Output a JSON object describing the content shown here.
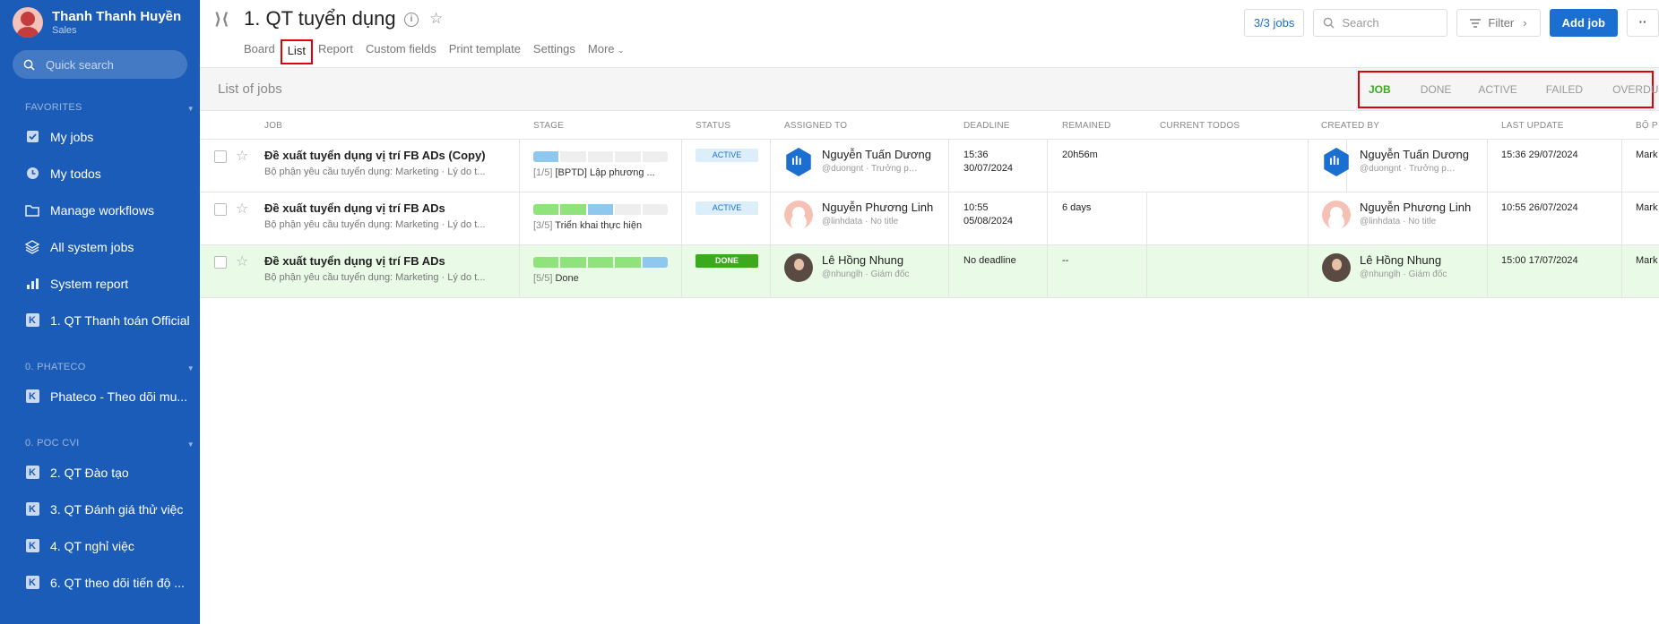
{
  "user": {
    "name": "Thanh Thanh Huyền",
    "role": "Sales"
  },
  "sidebar": {
    "search_placeholder": "Quick search",
    "sections": {
      "favorites": "FAVORITES",
      "phateco": "0. PHATECO",
      "poc": "0. POC CVI"
    },
    "items": {
      "my_jobs": "My jobs",
      "my_todos": "My todos",
      "manage_workflows": "Manage workflows",
      "all_system_jobs": "All system jobs",
      "system_report": "System report",
      "qt_thanh_toan": "1. QT Thanh toán Official",
      "phateco_theo_doi": "Phateco - Theo dõi mu...",
      "qt_dao_tao": "2. QT Đào tạo",
      "qt_danh_gia": "3. QT Đánh giá thử việc",
      "qt_nghi_viec": "4. QT nghỉ việc",
      "qt_theo_doi": "6. QT theo dõi tiến độ ..."
    }
  },
  "header": {
    "title": "1. QT tuyển dụng",
    "tabs": [
      "Board",
      "List",
      "Report",
      "Custom fields",
      "Print template",
      "Settings",
      "More"
    ],
    "jobs_count": "3/3 jobs",
    "search_placeholder": "Search",
    "filter_label": "Filter",
    "add_job_label": "Add job",
    "more_label": "··"
  },
  "subheader": {
    "title": "List of jobs",
    "filters": [
      "JOB",
      "DONE",
      "ACTIVE",
      "FAILED",
      "OVERDUE"
    ]
  },
  "table": {
    "columns": {
      "job": "JOB",
      "stage": "STAGE",
      "status": "STATUS",
      "assigned": "ASSIGNED TO",
      "deadline": "DEADLINE",
      "remained": "REMAINED",
      "todos": "CURRENT TODOS",
      "created": "CREATED BY",
      "updated": "LAST UPDATE",
      "bop": "BỘ P"
    },
    "rows": [
      {
        "title": "Đề xuất tuyển dụng vị trí FB ADs (Copy)",
        "subtitle": "Bộ phận yêu cầu tuyển dụng: Marketing · Lý do t...",
        "stage_num": "[1/5]",
        "stage_text": "[BPTD] Lập phương ...",
        "status": "ACTIVE",
        "assigned_name": "Nguyễn Tuấn Dương",
        "assigned_sub": "@duongnt · Trưởng phò...",
        "deadline_time": "15:36",
        "deadline_date": "30/07/2024",
        "remained": "20h56m",
        "created_name": "Nguyễn Tuấn Dương",
        "created_sub": "@duongnt · Trưởng phò...",
        "last_update": "15:36 29/07/2024",
        "bop": "Mark"
      },
      {
        "title": "Đề xuất tuyển dụng vị trí FB ADs",
        "subtitle": "Bộ phận yêu cầu tuyển dụng: Marketing · Lý do t...",
        "stage_num": "[3/5]",
        "stage_text": "Triển khai thực hiện",
        "status": "ACTIVE",
        "assigned_name": "Nguyễn Phương Linh",
        "assigned_sub": "@linhdata · No title",
        "deadline_time": "10:55",
        "deadline_date": "05/08/2024",
        "remained": "6 days",
        "created_name": "Nguyễn Phương Linh",
        "created_sub": "@linhdata · No title",
        "last_update": "10:55 26/07/2024",
        "bop": "Mark"
      },
      {
        "title": "Đề xuất tuyển dụng vị trí FB ADs",
        "subtitle": "Bộ phận yêu cầu tuyển dụng: Marketing · Lý do t...",
        "stage_num": "[5/5]",
        "stage_text": "Done",
        "status": "DONE",
        "assigned_name": "Lê Hồng Nhung",
        "assigned_sub": "@nhunglh · Giám đốc",
        "deadline_time": "No deadline",
        "deadline_date": "",
        "remained": "--",
        "created_name": "Lê Hồng Nhung",
        "created_sub": "@nhunglh · Giám đốc",
        "last_update": "15:00 17/07/2024",
        "bop": "Mark"
      }
    ]
  },
  "colors": {
    "sidebar": "#1b5cb8",
    "accent": "#1b6fd1",
    "done_green": "#3caa1e",
    "highlight_red": "#e0000a"
  }
}
